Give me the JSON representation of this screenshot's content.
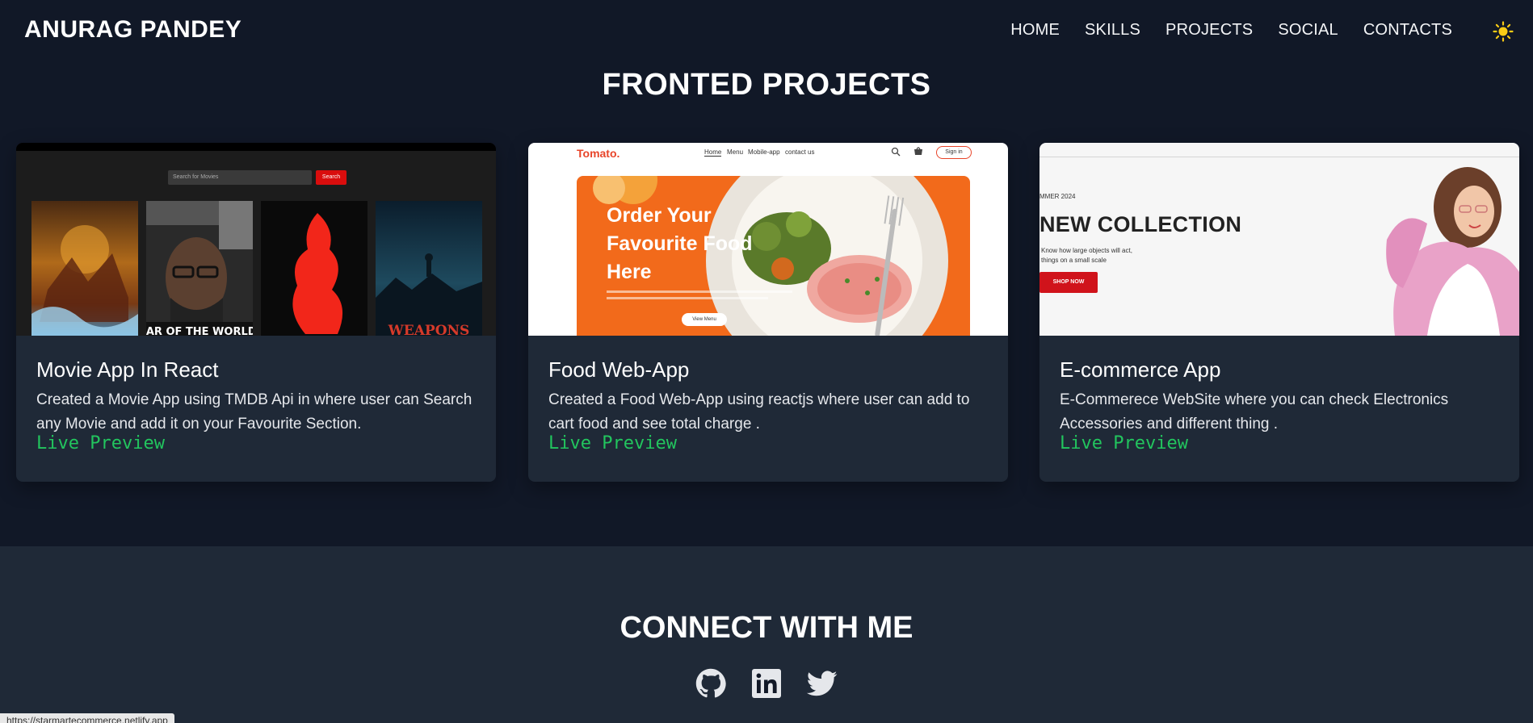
{
  "brand": "ANURAG PANDEY",
  "nav": {
    "items": [
      "HOME",
      "SKILLS",
      "PROJECTS",
      "SOCIAL",
      "CONTACTS"
    ],
    "theme_icon": "sun-icon"
  },
  "projects": {
    "title": "FRONTED PROJECTS",
    "cards": [
      {
        "title": "Movie App In React",
        "description": "Created a Movie App using TMDB Api in where user can Search any Movie and add it on your Favourite Section.",
        "link": "Live Preview",
        "thumb": {
          "search_placeholder": "Search for Movies",
          "search_button": "Search",
          "posters": [
            "",
            "WAR OF THE WORLDS",
            "",
            "WEAPONS"
          ]
        }
      },
      {
        "title": "Food Web-App",
        "description": "Created a Food Web-App using reactjs where user can add to cart food and see total charge .",
        "link": "Live Preview",
        "thumb": {
          "logo": "Tomato.",
          "nav": [
            "Home",
            "Menu",
            "Mobile-app",
            "contact us"
          ],
          "signin": "Sign in",
          "hero": "Order Your Favourite Food Here",
          "button": "View Menu"
        }
      },
      {
        "title": "E-commerce App",
        "description": "E-Commerece WebSite where you can check Electronics Accessories and different thing .",
        "link": "Live Preview",
        "thumb": {
          "season": "MMER 2024",
          "headline": "NEW COLLECTION",
          "sub1": "Know how large objects will act,",
          "sub2": "things on a small scale",
          "button": "SHOP NOW"
        }
      }
    ]
  },
  "connect": {
    "title": "CONNECT WITH ME",
    "icons": [
      "github-icon",
      "linkedin-icon",
      "twitter-icon"
    ]
  },
  "status_url": "https://starmartecommerce.netlify.app"
}
